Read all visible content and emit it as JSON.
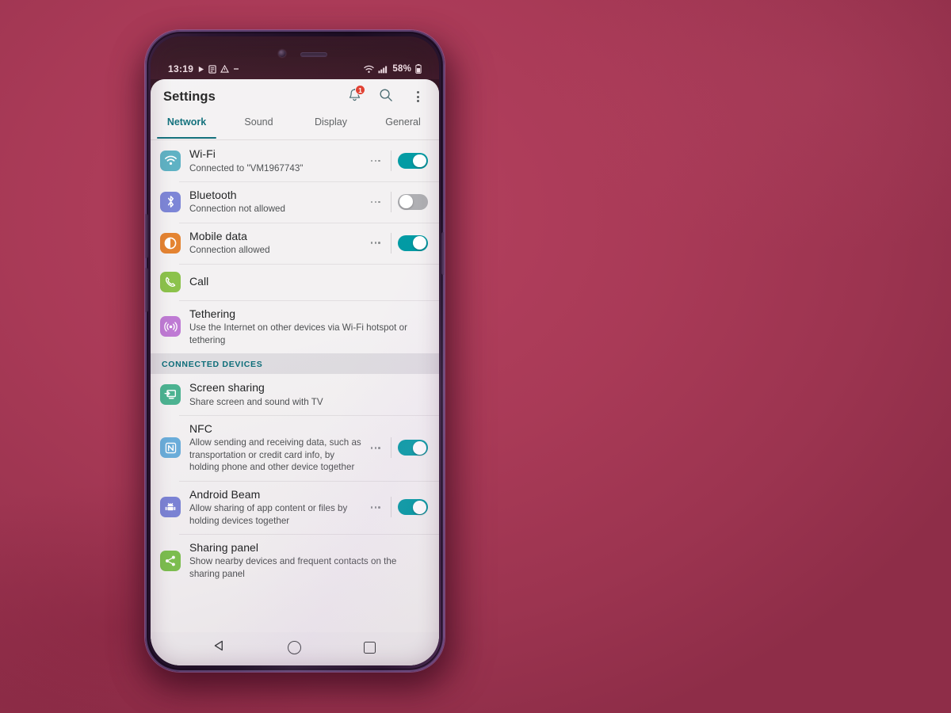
{
  "status_bar": {
    "time": "13:19",
    "left_icons": [
      "play-icon",
      "notes-icon",
      "warning-triangle-icon",
      "dash-icon"
    ],
    "wifi_icon": "wifi-icon",
    "signal_icon": "signal-bars-icon",
    "battery_percent": "58%",
    "battery_icon": "battery-icon"
  },
  "action_bar": {
    "title": "Settings",
    "notification_badge": "1",
    "icons": [
      "bell-icon",
      "search-icon",
      "overflow-menu-icon"
    ]
  },
  "tabs": [
    {
      "label": "Network",
      "active": true
    },
    {
      "label": "Sound",
      "active": false
    },
    {
      "label": "Display",
      "active": false
    },
    {
      "label": "General",
      "active": false
    }
  ],
  "sections": [
    {
      "header": null,
      "items": [
        {
          "icon": "wifi-icon",
          "icon_color": "#5bb0c2",
          "title": "Wi-Fi",
          "subtitle": "Connected to \"VM1967743\"",
          "has_menu": true,
          "toggle": "on"
        },
        {
          "icon": "bluetooth-icon",
          "icon_color": "#7b84d6",
          "title": "Bluetooth",
          "subtitle": "Connection not allowed",
          "has_menu": true,
          "toggle": "off"
        },
        {
          "icon": "mobile-data-icon",
          "icon_color": "#e4822f",
          "title": "Mobile data",
          "subtitle": "Connection allowed",
          "has_menu": true,
          "toggle": "on"
        },
        {
          "icon": "phone-call-icon",
          "icon_color": "#8bc24a",
          "title": "Call",
          "subtitle": null,
          "has_menu": false,
          "toggle": null
        },
        {
          "icon": "tethering-hotspot-icon",
          "icon_color": "#bf7ad4",
          "title": "Tethering",
          "subtitle": "Use the Internet on other devices via Wi-Fi hotspot or tethering",
          "has_menu": false,
          "toggle": null
        }
      ]
    },
    {
      "header": "CONNECTED DEVICES",
      "items": [
        {
          "icon": "screen-sharing-icon",
          "icon_color": "#4cb391",
          "title": "Screen sharing",
          "subtitle": "Share screen and sound with TV",
          "has_menu": false,
          "toggle": null
        },
        {
          "icon": "nfc-icon",
          "icon_color": "#6aaedb",
          "title": "NFC",
          "subtitle": "Allow sending and receiving data, such as transportation or credit card info, by holding phone and other device together",
          "has_menu": true,
          "toggle": "on"
        },
        {
          "icon": "android-beam-icon",
          "icon_color": "#7b84d6",
          "title": "Android Beam",
          "subtitle": "Allow sharing of app content or files by holding devices together",
          "has_menu": true,
          "toggle": "on"
        },
        {
          "icon": "sharing-panel-icon",
          "icon_color": "#7cc14e",
          "title": "Sharing panel",
          "subtitle": "Show nearby devices and frequent contacts on the sharing panel",
          "has_menu": false,
          "toggle": null
        }
      ]
    }
  ],
  "nav_bar": {
    "back": "back-icon",
    "home": "home-icon",
    "recents": "recents-icon"
  },
  "colors": {
    "accent_teal": "#0d6d79",
    "toggle_on": "#009aa3",
    "toggle_off": "#aeaeb2",
    "badge_red": "#e03b2c",
    "backdrop": "#a93a57"
  }
}
